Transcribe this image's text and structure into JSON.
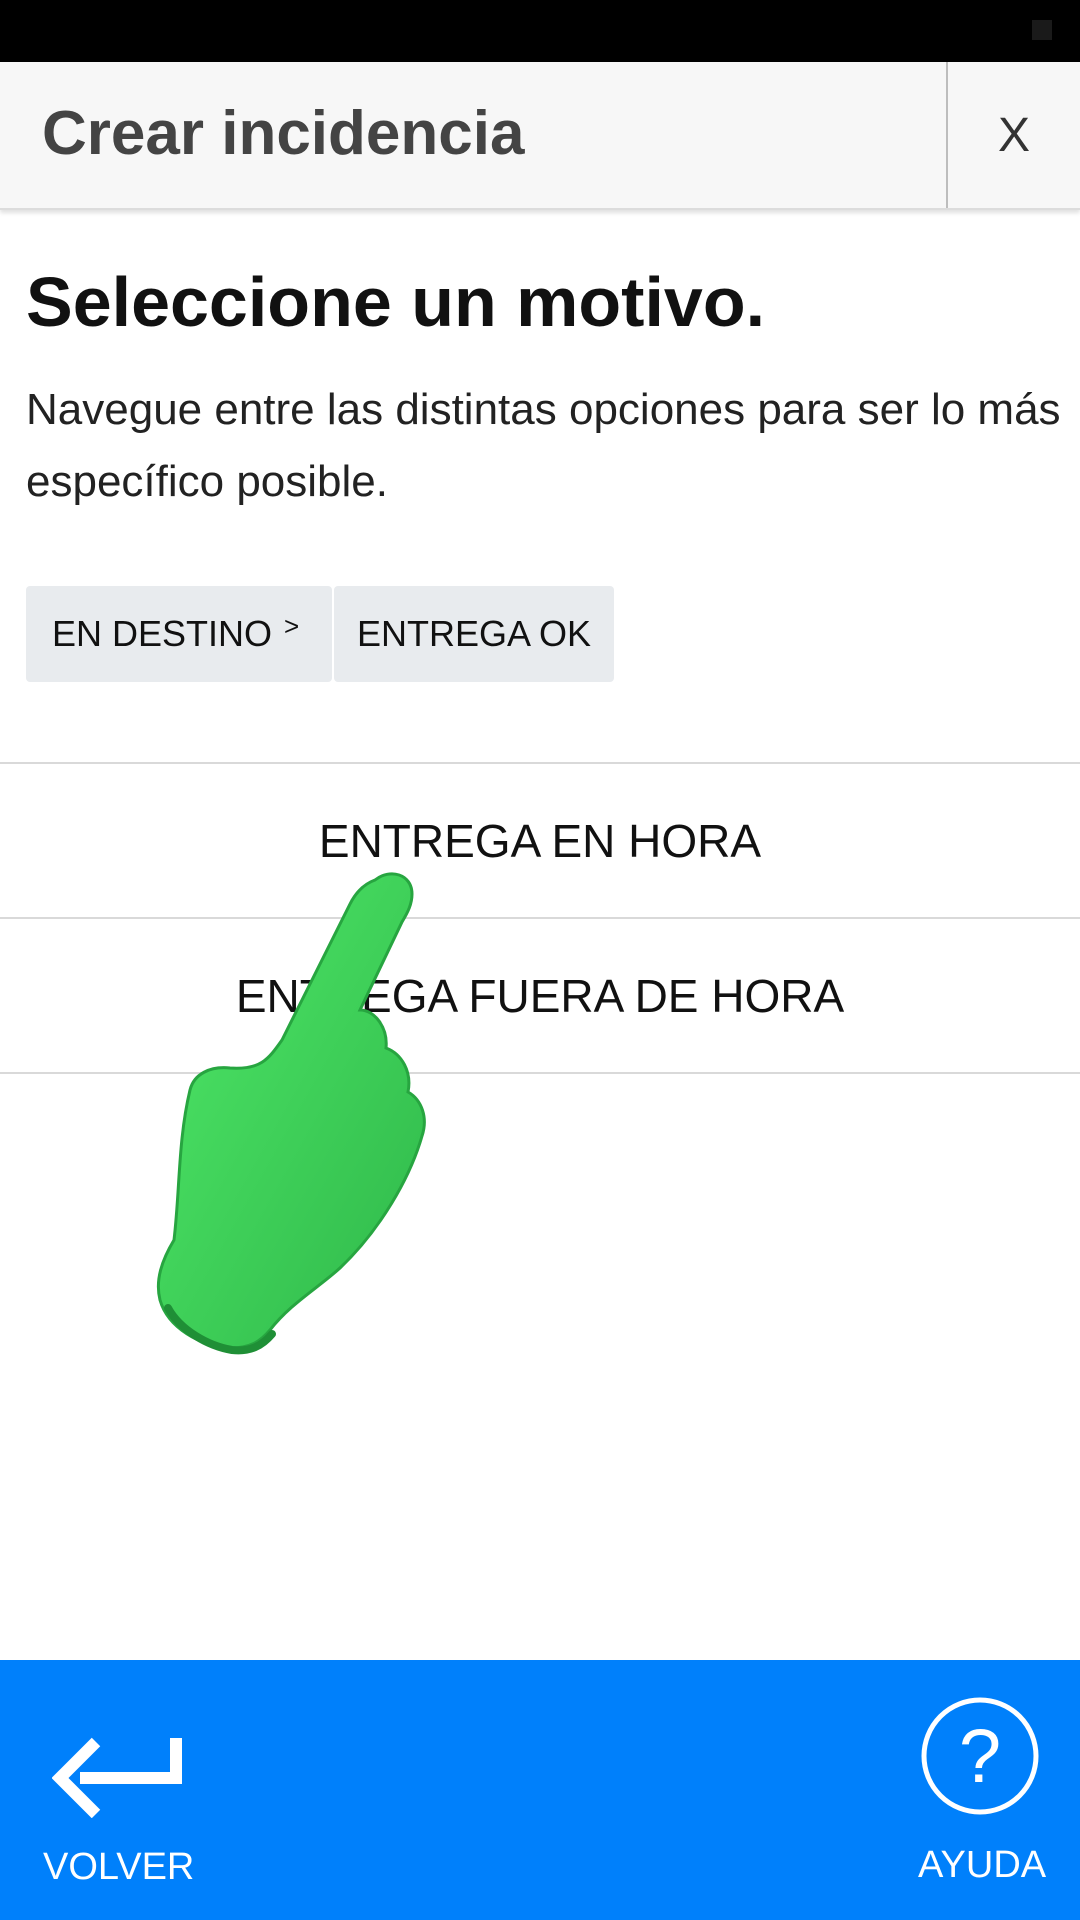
{
  "header": {
    "title": "Crear incidencia",
    "close_label": "X"
  },
  "main": {
    "heading": "Seleccione un motivo.",
    "description": "Navegue entre las distintas opciones para ser lo más específico posible.",
    "breadcrumb": [
      {
        "label": "EN DESTINO",
        "separator": ">"
      },
      {
        "label": "ENTREGA OK"
      }
    ],
    "options": [
      {
        "label": "ENTREGA EN HORA"
      },
      {
        "label": "ENTREGA FUERA DE HORA"
      }
    ]
  },
  "footer": {
    "back_label": "VOLVER",
    "help_label": "AYUDA"
  },
  "colors": {
    "accent": "#0080fb",
    "pointer": "#33c94f"
  },
  "icons": [
    "close-icon",
    "chevron-right-icon",
    "back-arrow-icon",
    "help-circle-icon",
    "pointing-hand-icon"
  ]
}
